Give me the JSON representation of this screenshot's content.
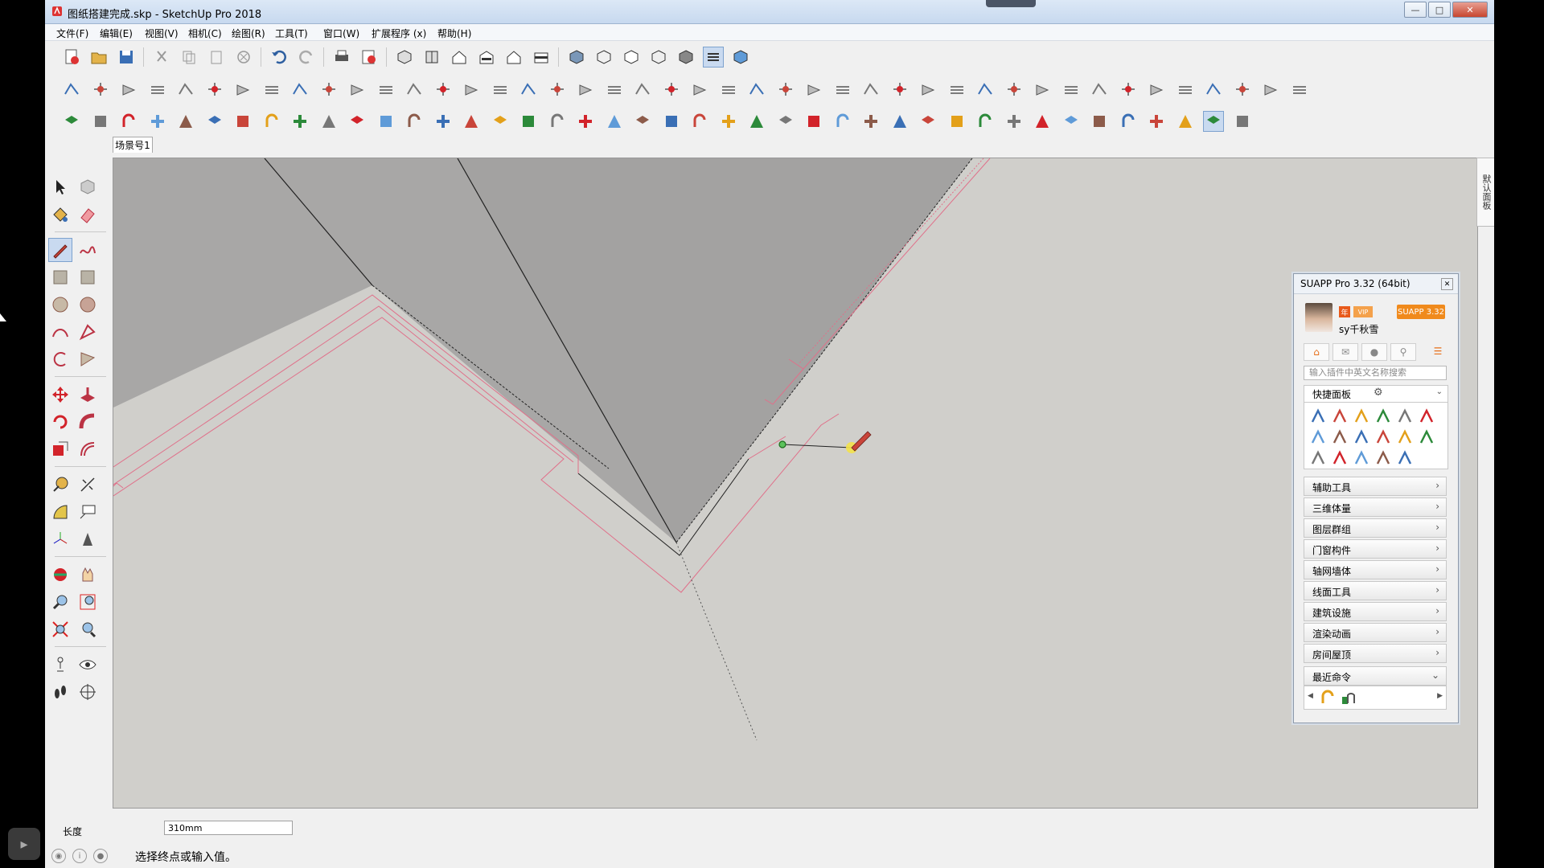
{
  "window": {
    "title": "图纸搭建完成.skp - SketchUp Pro 2018"
  },
  "menubar": [
    "文件(F)",
    "编辑(E)",
    "视图(V)",
    "相机(C)",
    "绘图(R)",
    "工具(T)",
    "窗口(W)",
    "扩展程序 (x)",
    "帮助(H)"
  ],
  "scene_tab": "场景号1",
  "right_strip_label": "默认面板",
  "suapp": {
    "title": "SUAPP Pro 3.32 (64bit)",
    "badge1": "年",
    "badge2": "VIP",
    "version_badge": "SUAPP 3.32",
    "username": "sy千秋雪",
    "search_placeholder": "输入插件中英文名称搜索",
    "quick_panel": "快捷面板",
    "categories": [
      "辅助工具",
      "三维体量",
      "图层群组",
      "门窗构件",
      "轴网墙体",
      "线面工具",
      "建筑设施",
      "渲染动画",
      "房间屋顶"
    ],
    "recent_label": "最近命令"
  },
  "vcb": {
    "label": "长度",
    "value": "310mm"
  },
  "status": {
    "text": "选择终点或输入值。"
  },
  "colors": {
    "accent": "#f08a1c",
    "guide_pink": "#e0708a",
    "face_gray": "#a8a7a6",
    "ground": "#d0cfcb"
  }
}
